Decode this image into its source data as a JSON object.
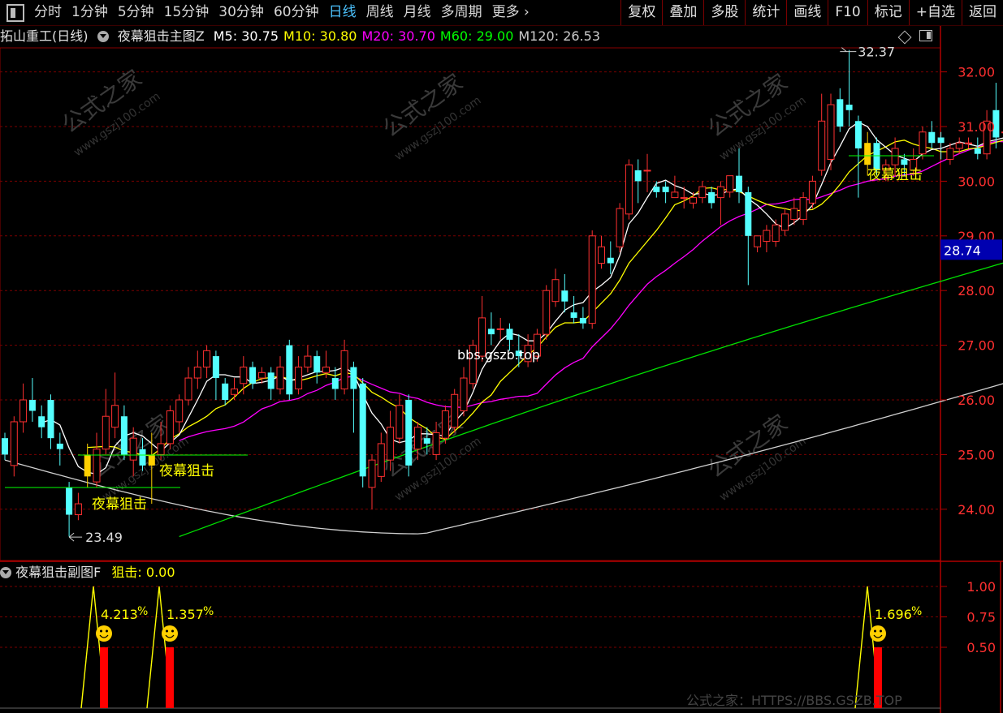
{
  "toolbar": {
    "periods": [
      "分时",
      "1分钟",
      "5分钟",
      "15分钟",
      "30分钟",
      "60分钟",
      "日线",
      "周线",
      "月线",
      "多周期",
      "更多"
    ],
    "active_index": 6,
    "buttons": [
      "复权",
      "叠加",
      "多股",
      "统计",
      "画线",
      "F10",
      "标记",
      "+自选",
      "返回"
    ]
  },
  "info": {
    "stock": "拓山重工(日线)",
    "indicator": "夜幕狙击主图Z",
    "ma": [
      {
        "label": "M5:",
        "value": "30.75",
        "color": "#ffffff"
      },
      {
        "label": "M10:",
        "value": "30.80",
        "color": "#ffff00"
      },
      {
        "label": "M20:",
        "value": "30.70",
        "color": "#ff00ff"
      },
      {
        "label": "M60:",
        "value": "29.00",
        "color": "#00ff00"
      },
      {
        "label": "M120:",
        "value": "26.53",
        "color": "#cccccc"
      }
    ]
  },
  "price_axis": {
    "ticks": [
      "32.00",
      "31.00",
      "30.00",
      "29.00",
      "28.00",
      "27.00",
      "26.00",
      "25.00",
      "24.00"
    ],
    "current": "28.74"
  },
  "annotations": {
    "high": "32.37",
    "low": "23.49",
    "signal_label": "夜幕狙击",
    "center_watermark": "bbs.gszb.top"
  },
  "sub": {
    "title": "夜幕狙击副图F",
    "value_label": "狙击:",
    "value": "0.00",
    "axis": [
      "1.00",
      "0.75",
      "0.50"
    ],
    "percents": [
      "4.213",
      "1.357",
      "1.696"
    ],
    "percent_sign": "%"
  },
  "watermark": {
    "brand": "公式之家",
    "site": "www.gszj100.com",
    "footer": "公式之家：HTTPS://BBS.GSZB.TOP"
  }
}
